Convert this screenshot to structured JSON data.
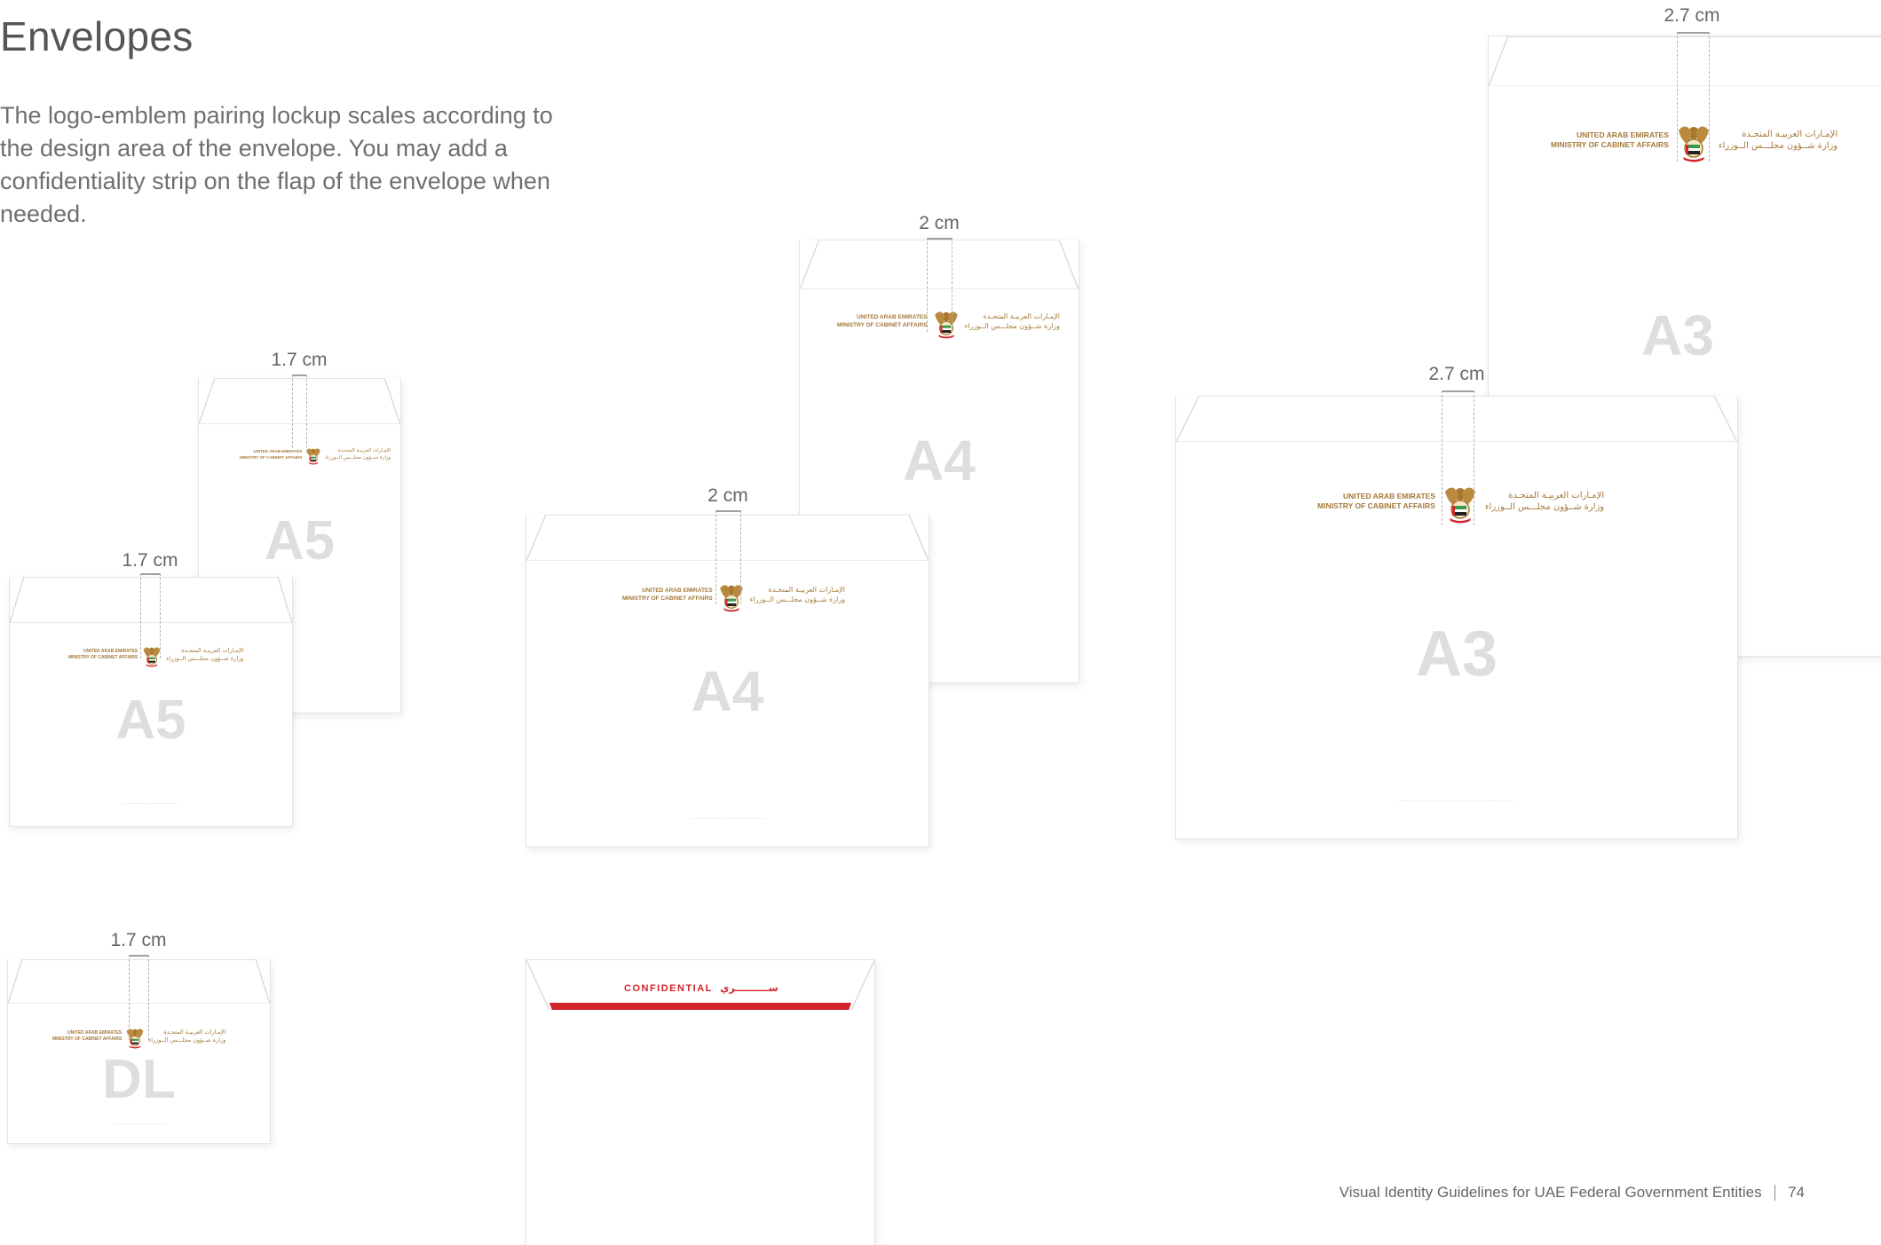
{
  "page": {
    "title": "Envelopes",
    "description": "The logo-emblem pairing lockup scales according to the design area of the envelope. You may add a confidentiality strip on the flap of the envelope when needed."
  },
  "lockup": {
    "en_line1": "UNITED ARAB EMIRATES",
    "en_line2": "MINISTRY OF CABINET AFFAIRS",
    "ar_line1": "الإمـارات العربيـة المتحـدة",
    "ar_line2": "وزارة شــؤون مجلـــس الــوزراء",
    "color": "#a5793a"
  },
  "envelopes": {
    "a5_portrait": {
      "size": "A5",
      "measure": "1.7 cm"
    },
    "a5_landscape": {
      "size": "A5",
      "measure": "1.7 cm"
    },
    "a4_portrait": {
      "size": "A4",
      "measure": "2 cm"
    },
    "a4_landscape": {
      "size": "A4",
      "measure": "2 cm"
    },
    "a3_portrait": {
      "size": "A3",
      "measure": "2.7 cm"
    },
    "a3_landscape": {
      "size": "A3",
      "measure": "2.7 cm"
    },
    "dl": {
      "size": "DL",
      "measure": "1.7 cm"
    },
    "confidential": {
      "en": "CONFIDENTIAL",
      "ar": "ســــــــــري",
      "color": "#d2232a"
    }
  },
  "footer": {
    "text": "Visual Identity Guidelines for UAE Federal Government Entities",
    "page_number": "74"
  }
}
